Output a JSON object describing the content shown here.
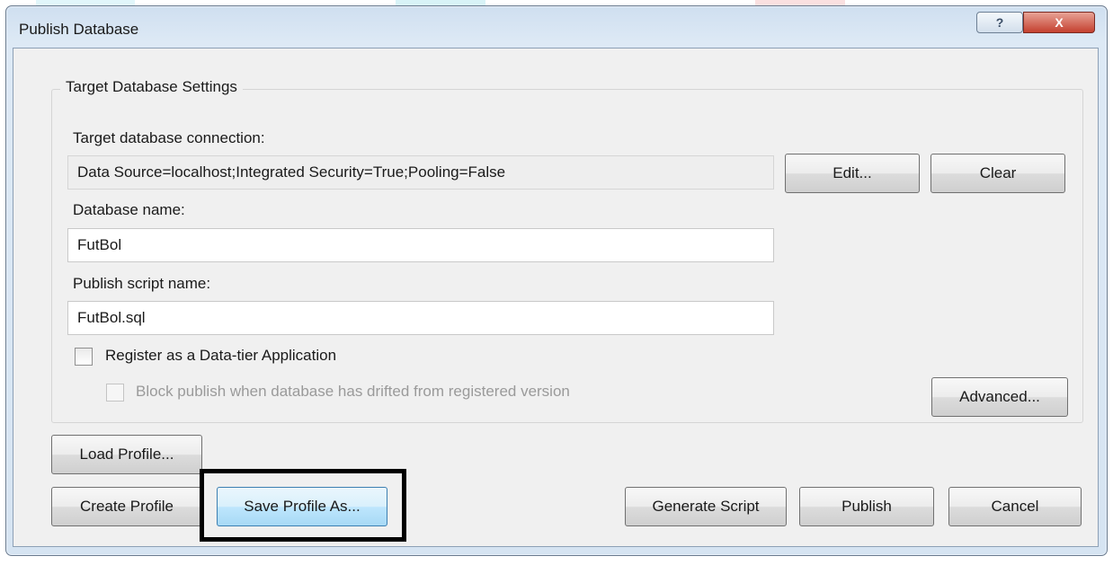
{
  "window": {
    "title": "Publish Database",
    "help_glyph": "?",
    "close_glyph": "X"
  },
  "target_settings": {
    "group_title": "Target Database Settings",
    "connection_label": "Target database connection:",
    "connection_value": "Data Source=localhost;Integrated Security=True;Pooling=False",
    "edit_button": "Edit...",
    "clear_button": "Clear",
    "db_name_label": "Database name:",
    "db_name_value": "FutBol",
    "script_name_label": "Publish script name:",
    "script_name_value": "FutBol.sql",
    "register_label": "Register as a Data-tier Application",
    "register_checked": false,
    "block_label": "Block publish when database has drifted from registered version",
    "block_checked": false,
    "advanced_button": "Advanced..."
  },
  "footer": {
    "load_profile": "Load Profile...",
    "create_profile": "Create Profile",
    "save_profile_as": "Save Profile As...",
    "generate_script": "Generate Script",
    "publish": "Publish",
    "cancel": "Cancel"
  },
  "colors": {
    "highlight_box": "#000000",
    "focused_button": "#bee6fd",
    "close_button": "#c4402f"
  }
}
